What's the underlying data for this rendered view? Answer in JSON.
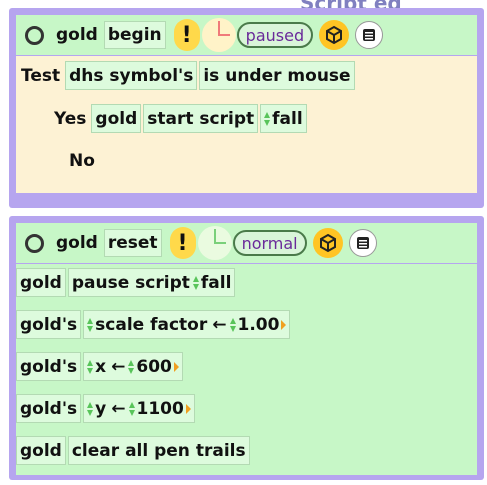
{
  "backdrop": {
    "partial_title": "Script ed"
  },
  "colors": {
    "panel_border": "#b6a5ef",
    "header_bg": "#c7f7c7",
    "tile_bg": "#ddfbdd",
    "test_body_bg": "#fdf2d4",
    "bang_yellow": "#ffd94a",
    "status_text": "#6a2a9a",
    "clock_hand_red": "#f07a7a",
    "clock_hand_green": "#7ad07a"
  },
  "scripts": [
    {
      "header": {
        "object": "gold",
        "script_name": "begin",
        "bang": "!",
        "clock_state": "paused",
        "status": "paused",
        "icons": [
          "circle-icon",
          "exclamation-icon",
          "clock-icon",
          "cube-icon",
          "menu-icon"
        ]
      },
      "test": {
        "keyword": "Test",
        "subject": "dhs symbol's",
        "condition": "is under mouse",
        "yes_label": "Yes",
        "yes_object": "gold",
        "yes_command": "start script",
        "yes_arg": "fall",
        "no_label": "No"
      }
    },
    {
      "header": {
        "object": "gold",
        "script_name": "reset",
        "bang": "!",
        "clock_state": "normal",
        "status": "normal",
        "icons": [
          "circle-icon",
          "exclamation-icon",
          "clock-icon",
          "cube-icon",
          "menu-icon"
        ]
      },
      "lines": [
        {
          "object": "gold",
          "command": "pause script",
          "arg": "fall"
        },
        {
          "object": "gold's",
          "property": "scale factor",
          "arrow": "←",
          "value": "1.00"
        },
        {
          "object": "gold's",
          "property": "x",
          "arrow": "←",
          "value": "600"
        },
        {
          "object": "gold's",
          "property": "y",
          "arrow": "←",
          "value": "1100"
        },
        {
          "object": "gold",
          "command": "clear all pen trails"
        }
      ]
    }
  ]
}
